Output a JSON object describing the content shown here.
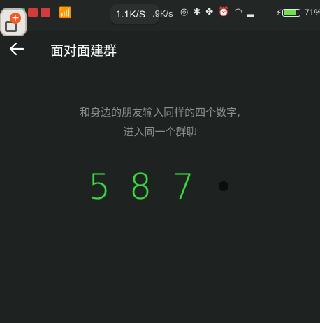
{
  "status_bar": {
    "speed": "1.1K/S",
    "speed_secondary": ".9K/s",
    "battery_percent": "71%"
  },
  "header": {
    "title": "面对面建群"
  },
  "instruction": {
    "line1": "和身边的朋友输入同样的四个数字,",
    "line2": "进入同一个群聊"
  },
  "code": {
    "digits": [
      "5",
      "8",
      "7"
    ],
    "remaining_placeholder_count": 1
  },
  "colors": {
    "background": "#1e2221",
    "digit": "#39d93f",
    "instruction_text": "#8a8d8c"
  }
}
